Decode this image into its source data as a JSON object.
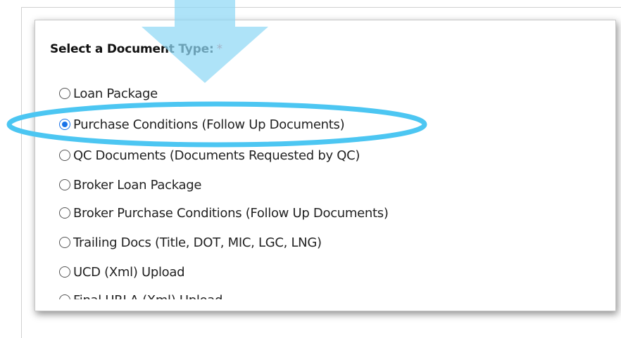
{
  "form": {
    "heading": "Select a Document Type:",
    "required_marker": "*",
    "selected_index": 1,
    "options": [
      {
        "label": "Loan Package"
      },
      {
        "label": "Purchase Conditions (Follow Up Documents)"
      },
      {
        "label": "QC Documents (Documents Requested by QC)"
      },
      {
        "label": "Broker Loan Package"
      },
      {
        "label": "Broker Purchase Conditions (Follow Up Documents)"
      },
      {
        "label": "Trailing Docs (Title, DOT, MIC, LGC, LNG)"
      },
      {
        "label": "UCD (Xml) Upload"
      },
      {
        "label": "Final URLA (Xml) Upload"
      }
    ]
  },
  "annotation": {
    "arrow_color": "#8fd8f5",
    "ellipse_color": "#4cc6f2"
  }
}
